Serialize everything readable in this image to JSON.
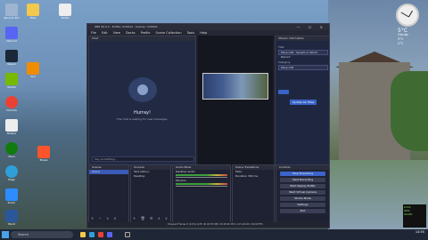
{
  "desktop": {
    "left_icons": [
      {
        "label": "Recycle Bin",
        "color": "#9fb4d0"
      },
      {
        "label": "Discord",
        "color": "#5865f2"
      },
      {
        "label": "Steam",
        "color": "#1b2838"
      },
      {
        "label": "Nvidia",
        "color": "#76b900"
      },
      {
        "label": "Chrome",
        "color": "#e94235"
      },
      {
        "label": "Roblox",
        "color": "#eee"
      },
      {
        "label": "Xbox",
        "color": "#107c10"
      },
      {
        "label": "Edge",
        "color": "#2f9fd8"
      },
      {
        "label": "Zoom",
        "color": "#2d8cff"
      },
      {
        "label": "Word",
        "color": "#2b579a"
      }
    ],
    "right_icons": [
      {
        "label": "Files",
        "color": "#f2c94c"
      },
      {
        "label": "VLC",
        "color": "#f08c00"
      },
      {
        "label": "Brave",
        "color": "#fb542b"
      },
      {
        "label": "Notes",
        "color": "#eee"
      }
    ]
  },
  "obs": {
    "title": "OBS 30.0.2 - Profile: Untitled - Scenes: Untitled",
    "window_controls": "—  ☐  ✕",
    "menu": [
      "File",
      "Edit",
      "View",
      "Docks",
      "Profile",
      "Scene Collection",
      "Tools",
      "Help"
    ],
    "chat": {
      "header": "Chat",
      "title": "Hurray!",
      "subtitle": "The chat is waiting for new messages.",
      "input_placeholder": "Say something..."
    },
    "stream_info": {
      "header": "Stream Information",
      "title_label": "Title",
      "title_value": "Minecraft - Speedrun World Record",
      "category_label": "Category",
      "category_value": "Minecraft",
      "update_button": "Update All Titles"
    },
    "scenes": {
      "header": "Scenes",
      "items": [
        "Scene"
      ],
      "tools": "+ − ∧ ∨"
    },
    "sources": {
      "header": "Sources",
      "items": [
        "Text (GDI+)",
        "Desktop"
      ],
      "tools": "+ 🗑 ⚙ ∧ ∨"
    },
    "mixer": {
      "header": "Audio Mixer",
      "channels": [
        "Desktop Audio",
        "Mic/Aux"
      ]
    },
    "transitions": {
      "header": "Scene Transitions",
      "type": "Fade",
      "duration_label": "Duration",
      "duration_value": "300 ms"
    },
    "controls": {
      "header": "Controls",
      "buttons": [
        "Stop Streaming",
        "Start Recording",
        "Start Replay Buffer",
        "Start Virtual Camera",
        "Studio Mode",
        "Settings",
        "Exit"
      ]
    },
    "status": "Dropped Frames 0 (0.0%)    LIVE: 00:43:55    REC: 00:00:00    CPU: 2.1%    60.00 / 60.00 FPS"
  },
  "taskbar": {
    "search_placeholder": "Search",
    "time": "14:55",
    "date": "3/1/2024"
  },
  "widgets": {
    "temperature": "5°C",
    "weather_lines": [
      "5°C",
      "Cloudy",
      "3°C",
      "2°C"
    ],
    "meter_lines": [
      "2.1%",
      "32%",
      "14.4%"
    ]
  }
}
